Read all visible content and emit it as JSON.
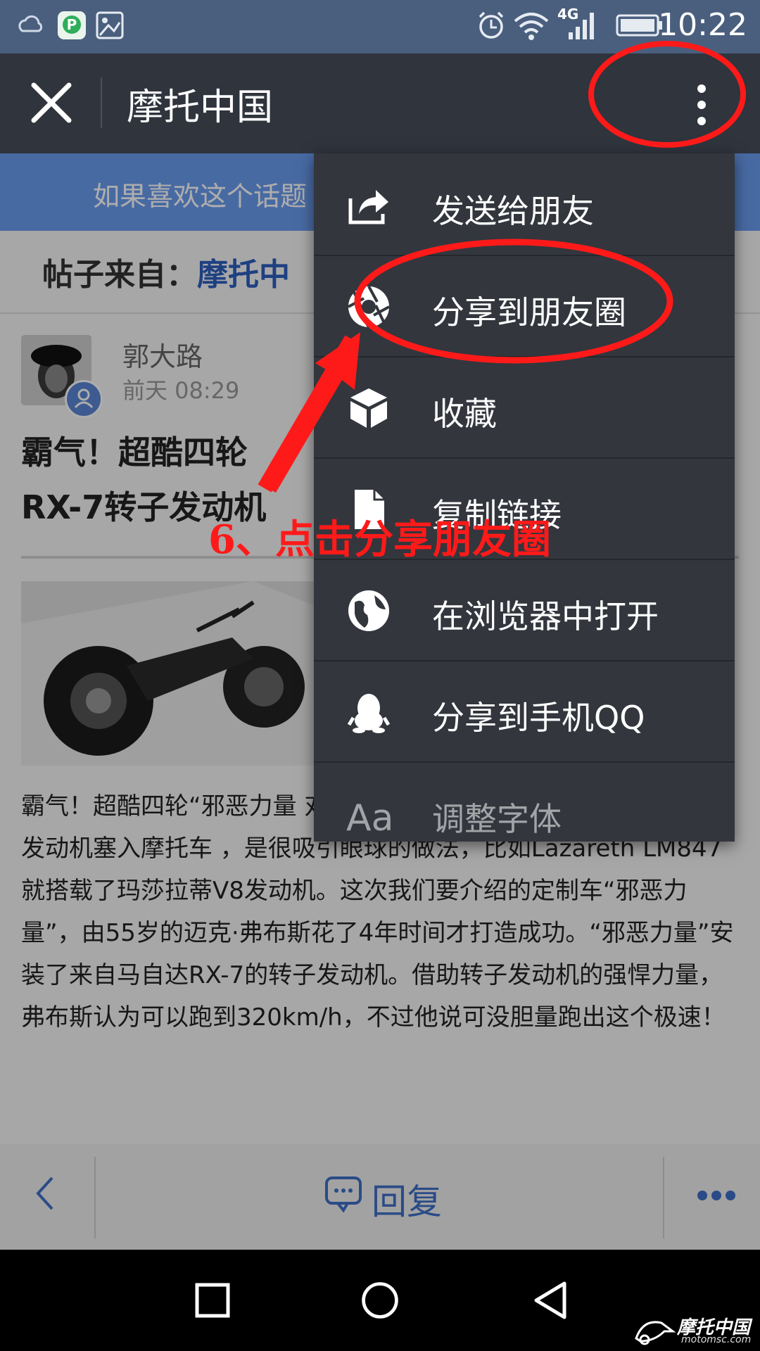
{
  "status_bar": {
    "time": "10:22",
    "network": "4G",
    "icons": [
      "weather-icon",
      "app-p-icon",
      "image-icon",
      "alarm-icon",
      "wifi-icon",
      "signal-icon",
      "battery-icon"
    ]
  },
  "header": {
    "title": "摩托中国"
  },
  "page": {
    "banner_text": "如果喜欢这个话题",
    "source_label": "帖子来自：",
    "source_link": "摩托中",
    "author": "郭大路",
    "post_time": "前天 08:29",
    "post_title": "霸气！超酷四轮",
    "post_title_line2": "RX-7转子发动机",
    "body": "霸气！超酷四轮“邪恶力量 对于定制摩托车来说，把一颗霸气的汽车发动机塞入摩托车 ，是很吸引眼球的做法，比如Lazareth LM847就搭载了玛莎拉蒂V8发动机。这次我们要介绍的定制车“邪恶力量”，由55岁的迈克·弗布斯花了4年时间才打造成功。“邪恶力量”安装了来自马自达RX-7的转子发动机。借助转子发动机的强悍力量，弗布斯认为可以跑到320km/h，不过他说可没胆量跑出这个极速！"
  },
  "menu": {
    "items": [
      {
        "label": "发送给朋友",
        "icon": "share-forward-icon"
      },
      {
        "label": "分享到朋友圈",
        "icon": "moments-shutter-icon"
      },
      {
        "label": "收藏",
        "icon": "cube-favorite-icon"
      },
      {
        "label": "复制链接",
        "icon": "document-link-icon"
      },
      {
        "label": "在浏览器中打开",
        "icon": "globe-icon"
      },
      {
        "label": "分享到手机QQ",
        "icon": "qq-penguin-icon"
      },
      {
        "label": "调整字体",
        "icon": "font-aa-icon"
      }
    ]
  },
  "toolbar": {
    "reply_label": "回复"
  },
  "annotation": {
    "text": "6、点击分享朋友圈",
    "color": "#ff1a1a"
  },
  "watermark": {
    "main": "摩托中国",
    "sub": "motomsc.com"
  }
}
